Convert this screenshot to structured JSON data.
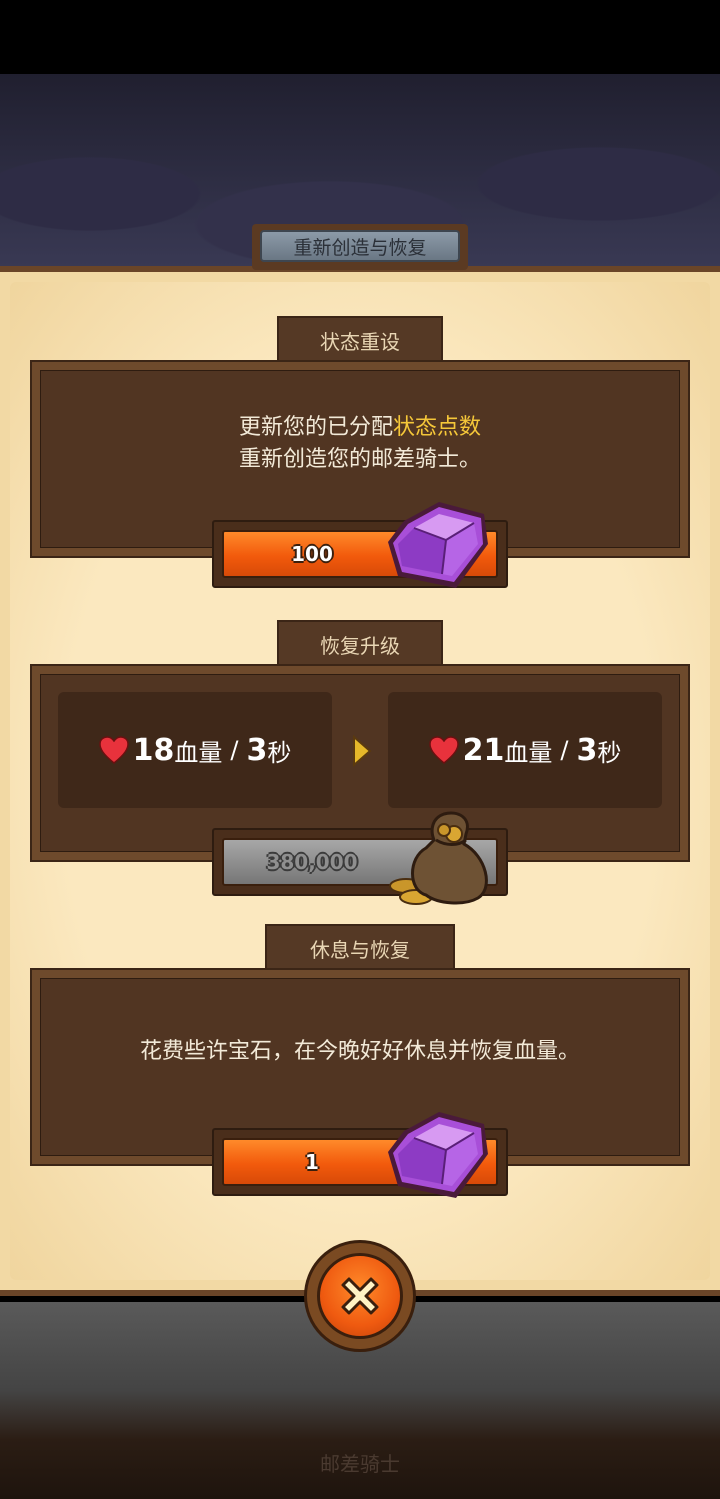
{
  "window_title": "重新创造与恢复",
  "sections": {
    "stat_reset": {
      "tab_label": "状态重设",
      "text_line1_prefix": "更新您的已分配",
      "text_line1_highlight": "状态点数",
      "text_line2": "重新创造您的邮差骑士。",
      "cost_value": "100",
      "currency_icon": "purple-gem-icon"
    },
    "recovery_upgrade": {
      "tab_label": "恢复升级",
      "current": {
        "amount": "18",
        "unit_hp": "血量",
        "separator": "/",
        "interval": "3",
        "unit_sec": "秒"
      },
      "next": {
        "amount": "21",
        "unit_hp": "血量",
        "separator": "/",
        "interval": "3",
        "unit_sec": "秒"
      },
      "cost_value": "380,000",
      "currency_icon": "gold-coin-bag-icon"
    },
    "rest_recover": {
      "tab_label": "休息与恢复",
      "text": "花费些许宝石，在今晚好好休息并恢复血量。",
      "cost_value": "1",
      "currency_icon": "purple-gem-icon"
    }
  },
  "footer_label": "邮差骑士",
  "colors": {
    "accent_orange": "#f25a0c",
    "highlight_yellow": "#f5c739",
    "panel_brown": "#513522",
    "parchment": "#fbe8bf"
  }
}
